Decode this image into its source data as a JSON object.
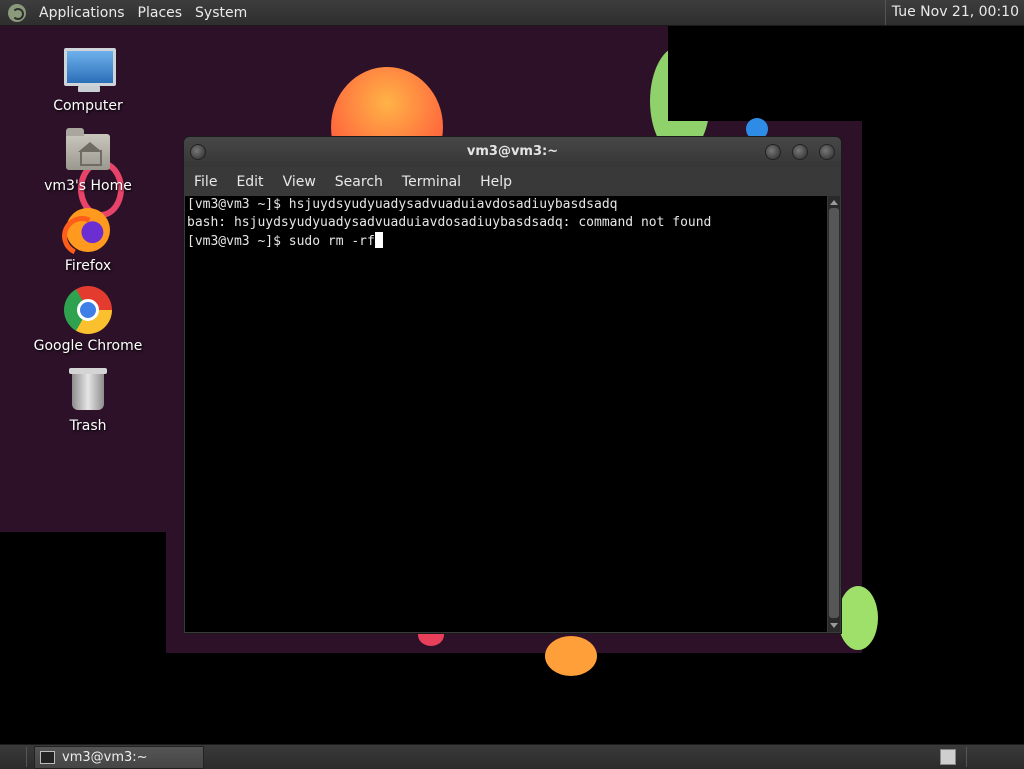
{
  "top_panel": {
    "menus": [
      "Applications",
      "Places",
      "System"
    ],
    "clock": "Tue Nov 21, 00:10"
  },
  "desktop_icons": [
    {
      "label": "Computer",
      "icon": "computer-icon"
    },
    {
      "label": "vm3's Home",
      "icon": "home-folder-icon"
    },
    {
      "label": "Firefox",
      "icon": "firefox-icon"
    },
    {
      "label": "Google Chrome",
      "icon": "chrome-icon"
    },
    {
      "label": "Trash",
      "icon": "trash-icon"
    }
  ],
  "terminal": {
    "title": "vm3@vm3:~",
    "menus": [
      "File",
      "Edit",
      "View",
      "Search",
      "Terminal",
      "Help"
    ],
    "lines": [
      "[vm3@vm3 ~]$ hsjuydsyudyuadysadvuaduiavdosadiuybasdsadq",
      "bash: hsjuydsyudyuadysadvuaduiavdosadiuybasdsadq: command not found"
    ],
    "current_line": "[vm3@vm3 ~]$ sudo rm -rf"
  },
  "bottom_panel": {
    "task_label": "vm3@vm3:~"
  }
}
